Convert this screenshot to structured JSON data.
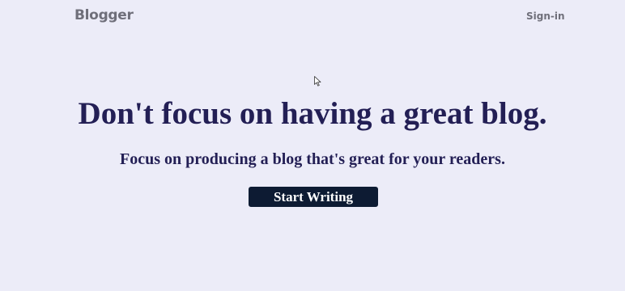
{
  "header": {
    "logo_text": "Blogger",
    "signin_label": "Sign-in"
  },
  "hero": {
    "headline": "Don't focus on having a great blog.",
    "subheadline": "Focus on producing a blog that's great for your readers.",
    "cta_label": "Start Writing"
  },
  "colors": {
    "background": "#ececf8",
    "nav_text": "#6f6f7a",
    "headline_text": "#231f55",
    "button_bg": "#0d1b33",
    "button_text": "#ffffff"
  },
  "icons": {
    "cursor": "mouse-pointer-icon"
  }
}
